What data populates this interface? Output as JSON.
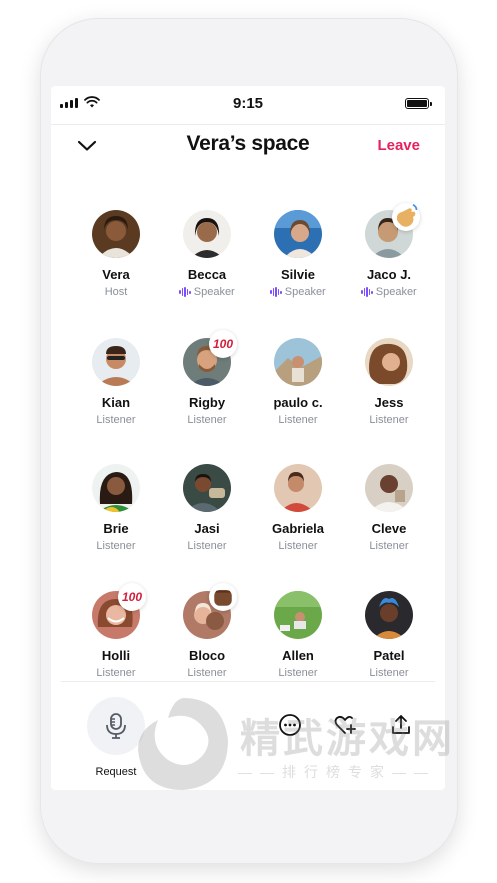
{
  "status_bar": {
    "time": "9:15"
  },
  "header": {
    "title": "Vera’s space",
    "leave_label": "Leave"
  },
  "participants": [
    {
      "name": "Vera",
      "role": "Host",
      "avatar": "avatar-vera"
    },
    {
      "name": "Becca",
      "role": "Speaker",
      "avatar": "avatar-becca"
    },
    {
      "name": "Silvie",
      "role": "Speaker",
      "avatar": "avatar-silvie"
    },
    {
      "name": "Jaco J.",
      "role": "Speaker",
      "avatar": "avatar-jaco",
      "reaction": "wave-emoji"
    },
    {
      "name": "Kian",
      "role": "Listener",
      "avatar": "avatar-kian"
    },
    {
      "name": "Rigby",
      "role": "Listener",
      "avatar": "avatar-rigby",
      "reaction": "hundred-emoji"
    },
    {
      "name": "paulo c.",
      "role": "Listener",
      "avatar": "avatar-paulo"
    },
    {
      "name": "Jess",
      "role": "Listener",
      "avatar": "avatar-jess"
    },
    {
      "name": "Brie",
      "role": "Listener",
      "avatar": "avatar-brie"
    },
    {
      "name": "Jasi",
      "role": "Listener",
      "avatar": "avatar-jasi"
    },
    {
      "name": "Gabriela",
      "role": "Listener",
      "avatar": "avatar-gabriela"
    },
    {
      "name": "Cleve",
      "role": "Listener",
      "avatar": "avatar-cleve"
    },
    {
      "name": "Holli",
      "role": "Listener",
      "avatar": "avatar-holli",
      "reaction": "hundred-emoji"
    },
    {
      "name": "Bloco",
      "role": "Listener",
      "avatar": "avatar-bloco",
      "reaction": "fist-emoji"
    },
    {
      "name": "Allen",
      "role": "Listener",
      "avatar": "avatar-allen"
    },
    {
      "name": "Patel",
      "role": "Listener",
      "avatar": "avatar-patel"
    }
  ],
  "reactions": {
    "hundred": "100"
  },
  "bottom_bar": {
    "request_label": "Request",
    "icons": [
      "microphone-icon",
      "more-icon",
      "heart-plus-icon",
      "share-icon"
    ]
  },
  "watermark": {
    "text": "精武游戏网",
    "subtext": "——排行榜专家——"
  },
  "colors": {
    "accent": "#e5215f",
    "speaker": "#7c4dff",
    "role_text": "#8a8f98"
  }
}
